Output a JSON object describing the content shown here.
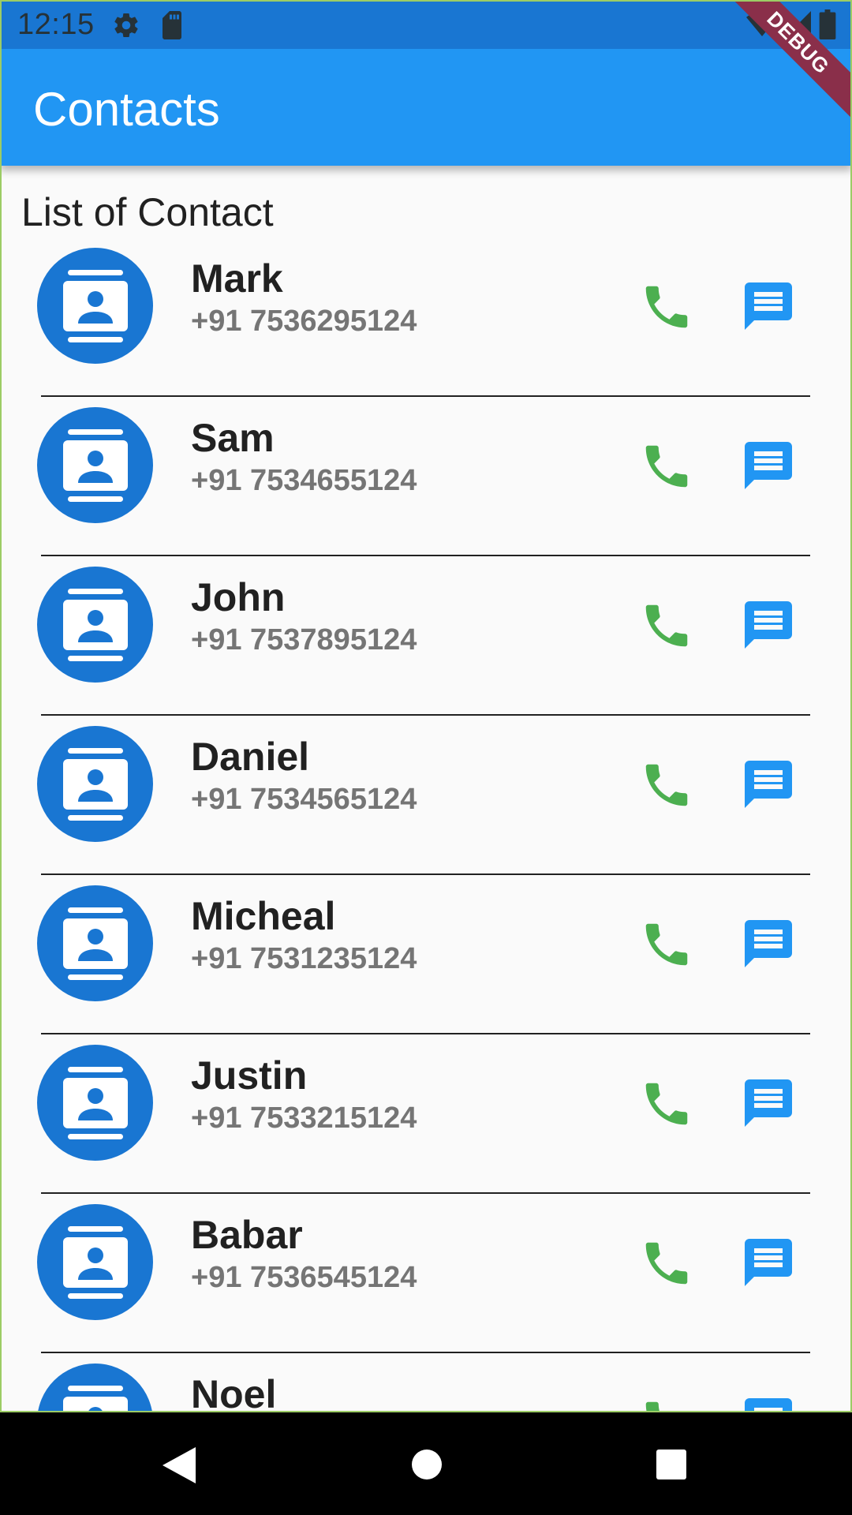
{
  "status_bar": {
    "time": "12:15",
    "icons": [
      "settings-icon",
      "sd-card-icon",
      "wifi-icon",
      "signal-icon",
      "battery-icon"
    ]
  },
  "app_bar": {
    "title": "Contacts",
    "debug_label": "DEBUG"
  },
  "content": {
    "section_title": "List of Contact",
    "contacts": [
      {
        "name": "Mark",
        "phone": "+91 7536295124"
      },
      {
        "name": "Sam",
        "phone": "+91 7534655124"
      },
      {
        "name": "John",
        "phone": "+91 7537895124"
      },
      {
        "name": "Daniel",
        "phone": "+91 7534565124"
      },
      {
        "name": "Micheal",
        "phone": "+91 7531235124"
      },
      {
        "name": "Justin",
        "phone": "+91 7533215124"
      },
      {
        "name": "Babar",
        "phone": "+91 7536545124"
      },
      {
        "name": "Noel",
        "phone": ""
      }
    ]
  },
  "nav_bar": {
    "icons": [
      "back-icon",
      "home-icon",
      "recents-icon"
    ]
  },
  "colors": {
    "status_bar": "#1976d2",
    "app_bar": "#2196f3",
    "avatar": "#1976d2",
    "call_icon": "#4caf50",
    "message_icon": "#2196f3",
    "background": "#fafafa"
  }
}
